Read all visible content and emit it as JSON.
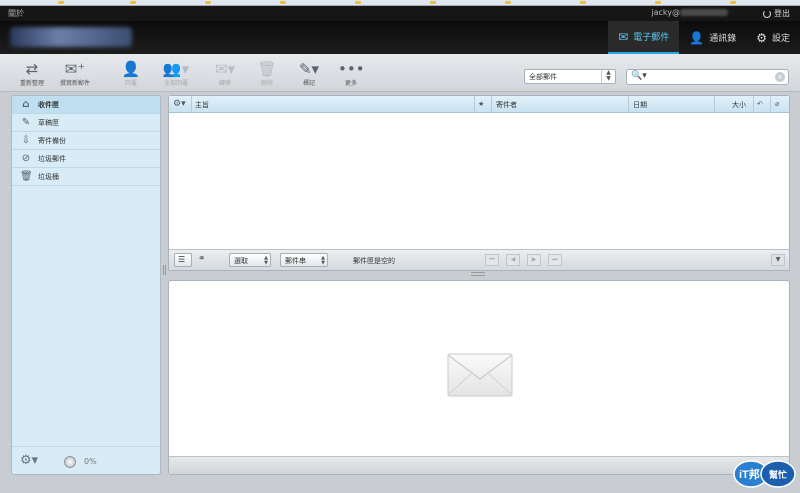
{
  "topbar": {
    "about_label": "關於",
    "username": "jacky@",
    "logout_label": "登出"
  },
  "nav": {
    "items": [
      {
        "label": "電子郵件",
        "icon": "envelope-icon",
        "active": true
      },
      {
        "label": "通訊錄",
        "icon": "person-icon",
        "active": false
      },
      {
        "label": "設定",
        "icon": "gear-icon",
        "active": false
      }
    ]
  },
  "toolbar": {
    "buttons": [
      {
        "label": "重新整理",
        "icon": "refresh-icon",
        "enabled": true
      },
      {
        "label": "撰寫新郵件",
        "icon": "compose-icon",
        "enabled": true
      },
      {
        "label": "回覆",
        "icon": "reply-icon",
        "enabled": false
      },
      {
        "label": "全部回覆",
        "icon": "reply-all-icon",
        "enabled": false
      },
      {
        "label": "轉寄",
        "icon": "forward-icon",
        "enabled": false
      },
      {
        "label": "刪除",
        "icon": "trash-icon",
        "enabled": false
      },
      {
        "label": "標記",
        "icon": "mark-icon",
        "enabled": true
      },
      {
        "label": "更多",
        "icon": "more-icon",
        "enabled": true
      }
    ],
    "filter_value": "全部郵件",
    "search_placeholder": ""
  },
  "sidebar": {
    "folders": [
      {
        "label": "收件匣",
        "icon": "inbox-icon",
        "active": true
      },
      {
        "label": "草稿匣",
        "icon": "pencil-icon",
        "active": false
      },
      {
        "label": "寄件備份",
        "icon": "sent-icon",
        "active": false
      },
      {
        "label": "垃圾郵件",
        "icon": "junk-icon",
        "active": false
      },
      {
        "label": "垃圾桶",
        "icon": "trash-icon",
        "active": false
      }
    ],
    "quota_percent": "0%"
  },
  "list": {
    "columns": {
      "subject": "主旨",
      "star": "★",
      "from": "寄件者",
      "date": "日期",
      "size": "大小"
    },
    "footer": {
      "select_label": "選取",
      "threads_label": "郵件串",
      "status": "郵件匣是空的"
    }
  },
  "watermark": {
    "line1": "iT邦",
    "line2": "幫忙"
  }
}
